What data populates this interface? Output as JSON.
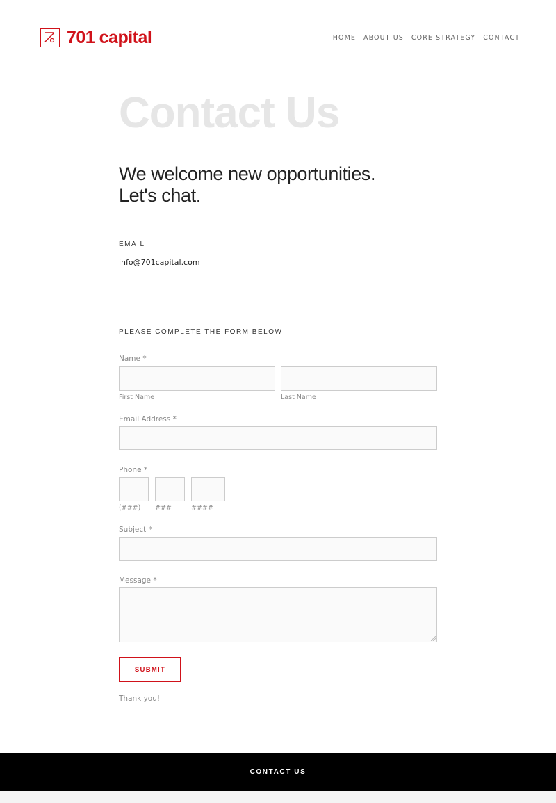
{
  "brand": {
    "name": "701 capital",
    "color": "#d0121a"
  },
  "nav": {
    "items": [
      {
        "label": "HOME"
      },
      {
        "label": "ABOUT US"
      },
      {
        "label": "CORE STRATEGY"
      },
      {
        "label": "CONTACT"
      }
    ]
  },
  "main": {
    "title": "Contact Us",
    "lede": "We welcome new opportunities. Let's chat.",
    "email_heading": "EMAIL",
    "email_value": "info@701capital.com",
    "form_heading": "PLEASE COMPLETE THE FORM BELOW"
  },
  "form": {
    "name_label": "Name",
    "required_mark": "*",
    "first_name_label": "First Name",
    "last_name_label": "Last Name",
    "email_label": "Email Address",
    "phone_label": "Phone",
    "phone_area_hint": "(###)",
    "phone_prefix_hint": "###",
    "phone_line_hint": "####",
    "subject_label": "Subject",
    "message_label": "Message",
    "submit_label": "SUBMIT",
    "thanks_text": "Thank you!"
  },
  "footer": {
    "label": "CONTACT US"
  }
}
